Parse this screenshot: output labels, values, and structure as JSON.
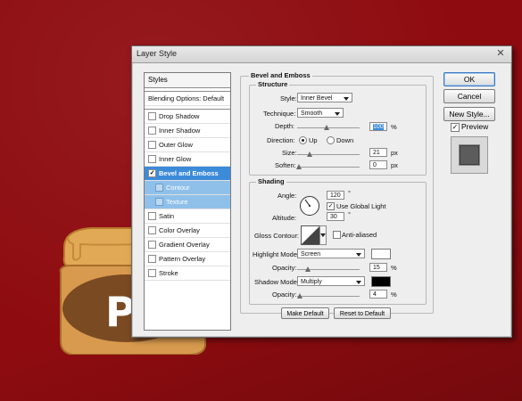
{
  "dialog": {
    "title": "Layer Style",
    "close_glyph": "✕"
  },
  "styles_list": {
    "header": "Styles",
    "blending": "Blending Options: Default",
    "items": [
      {
        "label": "Drop Shadow",
        "checked": ""
      },
      {
        "label": "Inner Shadow",
        "checked": ""
      },
      {
        "label": "Outer Glow",
        "checked": ""
      },
      {
        "label": "Inner Glow",
        "checked": ""
      },
      {
        "label": "Bevel and Emboss",
        "checked": "✓"
      },
      {
        "label": "Contour",
        "checked": ""
      },
      {
        "label": "Texture",
        "checked": ""
      },
      {
        "label": "Satin",
        "checked": ""
      },
      {
        "label": "Color Overlay",
        "checked": ""
      },
      {
        "label": "Gradient Overlay",
        "checked": ""
      },
      {
        "label": "Pattern Overlay",
        "checked": ""
      },
      {
        "label": "Stroke",
        "checked": ""
      }
    ]
  },
  "buttons": {
    "ok": "OK",
    "cancel": "Cancel",
    "new_style": "New Style...",
    "preview_label": "Preview",
    "preview_checked": "✓",
    "make_default": "Make Default",
    "reset_default": "Reset to Default"
  },
  "bevel": {
    "section_title": "Bevel and Emboss",
    "structure_title": "Structure",
    "style_label": "Style:",
    "style_value": "Inner Bevel",
    "technique_label": "Technique:",
    "technique_value": "Smooth",
    "depth_label": "Depth:",
    "depth_value": "100",
    "depth_unit": "%",
    "direction_label": "Direction:",
    "dir_up": "Up",
    "dir_down": "Down",
    "size_label": "Size:",
    "size_value": "21",
    "size_unit": "px",
    "soften_label": "Soften:",
    "soften_value": "0",
    "soften_unit": "px"
  },
  "shading": {
    "title": "Shading",
    "angle_label": "Angle:",
    "angle_value": "120",
    "degree": "°",
    "global_light_label": "Use Global Light",
    "global_light_checked": "✓",
    "altitude_label": "Altitude:",
    "altitude_value": "30",
    "gloss_label": "Gloss Contour:",
    "anti_alias_label": "Anti-aliased",
    "highlight_label": "Highlight Mode:",
    "highlight_value": "Screen",
    "highlight_color": "#ffffff",
    "opacity_label": "Opacity:",
    "highlight_opacity": "15",
    "pct": "%",
    "shadow_label": "Shadow Mode:",
    "shadow_value": "Multiply",
    "shadow_color": "#000000",
    "shadow_opacity": "4"
  }
}
